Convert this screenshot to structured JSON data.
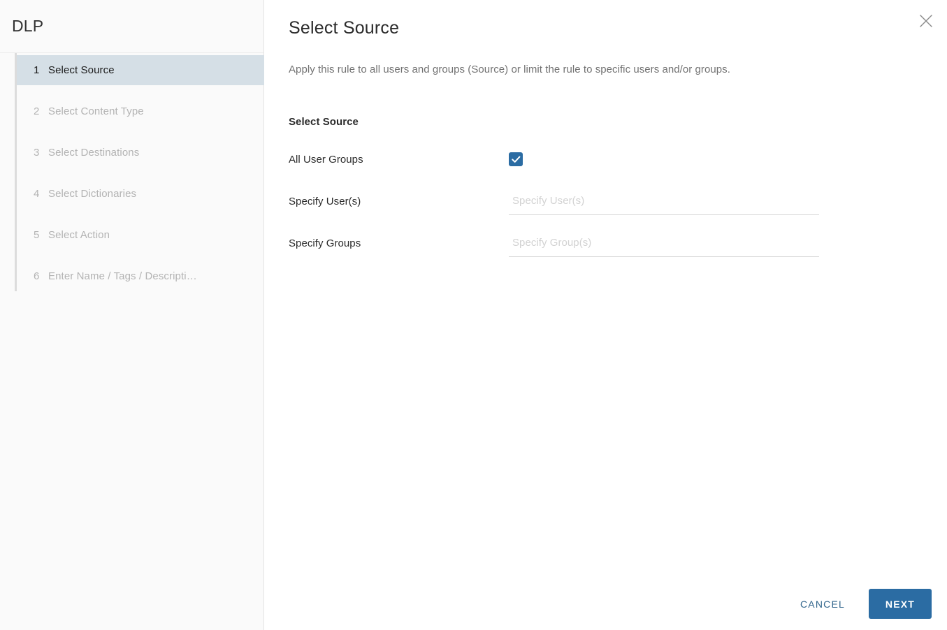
{
  "sidebar": {
    "title": "DLP",
    "steps": [
      {
        "num": "1",
        "label": "Select Source",
        "state": "active"
      },
      {
        "num": "2",
        "label": "Select Content Type",
        "state": "disabled"
      },
      {
        "num": "3",
        "label": "Select Destinations",
        "state": "disabled"
      },
      {
        "num": "4",
        "label": "Select Dictionaries",
        "state": "disabled"
      },
      {
        "num": "5",
        "label": "Select Action",
        "state": "disabled"
      },
      {
        "num": "6",
        "label": "Enter Name / Tags / Descripti…",
        "state": "disabled"
      }
    ]
  },
  "main": {
    "title": "Select Source",
    "description": "Apply this rule to all users and groups (Source) or limit the rule to specific users and/or groups.",
    "section_label": "Select Source",
    "close_icon": "close-icon",
    "fields": {
      "all_user_groups": {
        "label": "All User Groups",
        "checked": true,
        "icon": "check-icon"
      },
      "specify_users": {
        "label": "Specify User(s)",
        "placeholder": "Specify User(s)",
        "value": ""
      },
      "specify_groups": {
        "label": "Specify Groups",
        "placeholder": "Specify Group(s)",
        "value": ""
      }
    }
  },
  "footer": {
    "cancel_label": "CANCEL",
    "next_label": "NEXT"
  },
  "colors": {
    "accent": "#2b6ca3",
    "link": "#31658c",
    "active_step_bg": "#d5dfe6",
    "sidebar_bg": "#fafafa",
    "muted_text": "#b3b3b3"
  }
}
